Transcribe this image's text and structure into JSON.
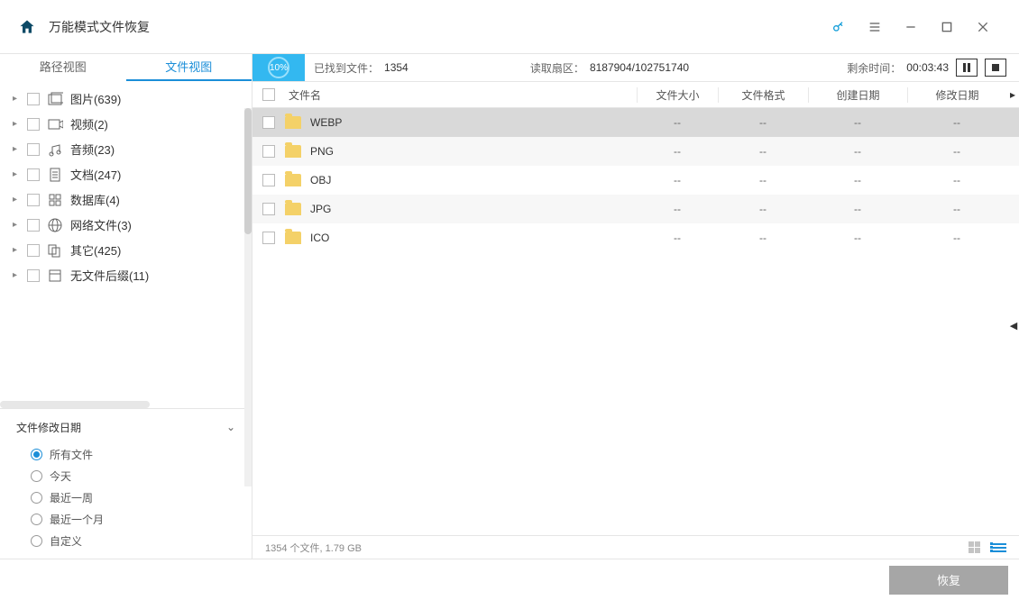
{
  "title": "万能模式文件恢复",
  "tabs": {
    "path": "路径视图",
    "file": "文件视图"
  },
  "tree": [
    {
      "label": "图片(639)",
      "icon": "images"
    },
    {
      "label": "视频(2)",
      "icon": "video"
    },
    {
      "label": "音频(23)",
      "icon": "audio"
    },
    {
      "label": "文档(247)",
      "icon": "doc"
    },
    {
      "label": "数据库(4)",
      "icon": "db"
    },
    {
      "label": "网络文件(3)",
      "icon": "web"
    },
    {
      "label": "其它(425)",
      "icon": "other"
    },
    {
      "label": "无文件后缀(11)",
      "icon": "noext"
    }
  ],
  "filter": {
    "title": "文件修改日期",
    "options": [
      "所有文件",
      "今天",
      "最近一周",
      "最近一个月",
      "自定义"
    ],
    "selected": 0
  },
  "status": {
    "progress": "10%",
    "found_label": "已找到文件：",
    "found_value": "1354",
    "sector_label": "读取扇区：",
    "sector_value": "8187904/102751740",
    "remain_label": "剩余时间：",
    "remain_value": "00:03:43"
  },
  "columns": {
    "name": "文件名",
    "size": "文件大小",
    "fmt": "文件格式",
    "cdate": "创建日期",
    "mdate": "修改日期"
  },
  "rows": [
    {
      "name": "WEBP",
      "size": "--",
      "fmt": "--",
      "cdate": "--",
      "mdate": "--",
      "selected": true
    },
    {
      "name": "PNG",
      "size": "--",
      "fmt": "--",
      "cdate": "--",
      "mdate": "--"
    },
    {
      "name": "OBJ",
      "size": "--",
      "fmt": "--",
      "cdate": "--",
      "mdate": "--"
    },
    {
      "name": "JPG",
      "size": "--",
      "fmt": "--",
      "cdate": "--",
      "mdate": "--"
    },
    {
      "name": "ICO",
      "size": "--",
      "fmt": "--",
      "cdate": "--",
      "mdate": "--"
    }
  ],
  "footer": {
    "summary": "1354 个文件, 1.79 GB"
  },
  "recover_label": "恢复"
}
